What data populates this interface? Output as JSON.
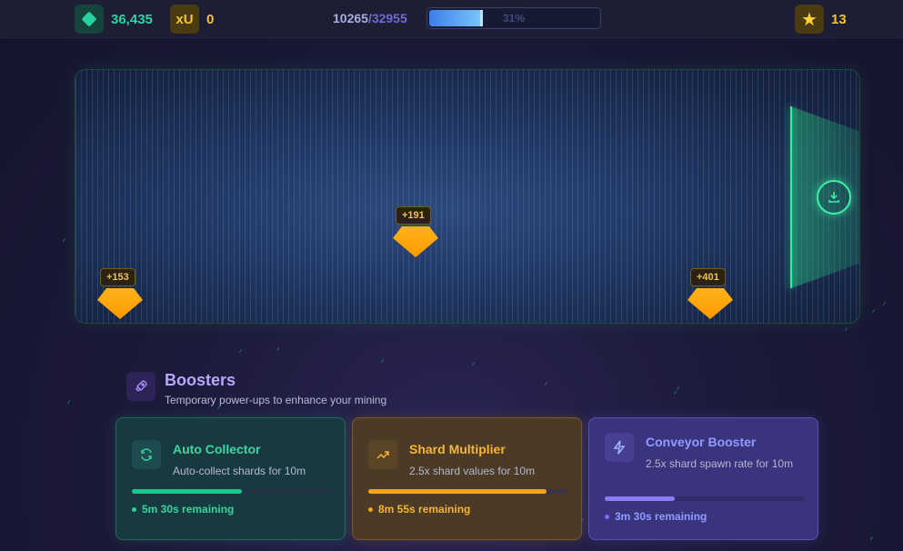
{
  "topbar": {
    "gems": "36,435",
    "xu_icon": "xU",
    "xu_value": "0",
    "progress_current": "10265",
    "progress_sep": "/",
    "progress_max": "32955",
    "progress_percent_label": "31%",
    "progress_fraction": 0.31,
    "stars": "13"
  },
  "conveyor": {
    "shards": [
      {
        "label": "+153"
      },
      {
        "label": "+191"
      },
      {
        "label": "+401"
      }
    ],
    "collector_icon": "download-icon"
  },
  "boosters": {
    "title": "Boosters",
    "subtitle": "Temporary power-ups to enhance your mining",
    "items": [
      {
        "title": "Auto Collector",
        "desc": "Auto-collect shards for 10m",
        "remaining": "5m 30s remaining",
        "progress": 0.55,
        "icon": "refresh-icon",
        "color": "#1ec489"
      },
      {
        "title": "Shard Multiplier",
        "desc": "2.5x shard values for 10m",
        "remaining": "8m 55s remaining",
        "progress": 0.89,
        "icon": "trending-up-icon",
        "color": "#f5a70e"
      },
      {
        "title": "Conveyor Booster",
        "desc": "2.5x shard spawn rate for 10m",
        "remaining": "3m 30s remaining",
        "progress": 0.35,
        "icon": "lightning-icon",
        "color": "#8b7cf6"
      }
    ]
  }
}
